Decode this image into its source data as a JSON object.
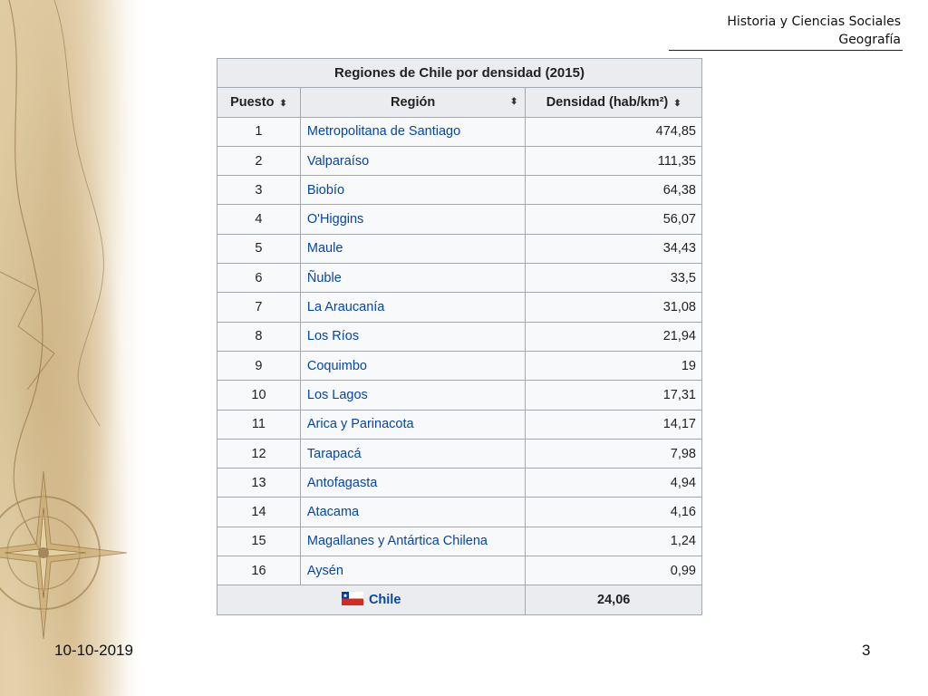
{
  "header": {
    "line1": "Historia y Ciencias Sociales",
    "line2": "Geografía"
  },
  "table": {
    "caption": "Regiones de Chile por densidad (2015)",
    "columns": [
      "Puesto",
      "Región",
      "Densidad (hab/km²)"
    ],
    "rows": [
      {
        "rank": "1",
        "region": "Metropolitana de Santiago",
        "density": "474,85"
      },
      {
        "rank": "2",
        "region": "Valparaíso",
        "density": "111,35"
      },
      {
        "rank": "3",
        "region": "Biobío",
        "density": "64,38"
      },
      {
        "rank": "4",
        "region": "O'Higgins",
        "density": "56,07"
      },
      {
        "rank": "5",
        "region": "Maule",
        "density": "34,43"
      },
      {
        "rank": "6",
        "region": "Ñuble",
        "density": "33,5"
      },
      {
        "rank": "7",
        "region": "La Araucanía",
        "density": "31,08"
      },
      {
        "rank": "8",
        "region": "Los Ríos",
        "density": "21,94"
      },
      {
        "rank": "9",
        "region": "Coquimbo",
        "density": "19"
      },
      {
        "rank": "10",
        "region": "Los Lagos",
        "density": "17,31"
      },
      {
        "rank": "11",
        "region": "Arica y Parinacota",
        "density": "14,17"
      },
      {
        "rank": "12",
        "region": "Tarapacá",
        "density": "7,98"
      },
      {
        "rank": "13",
        "region": "Antofagasta",
        "density": "4,94"
      },
      {
        "rank": "14",
        "region": "Atacama",
        "density": "4,16"
      },
      {
        "rank": "15",
        "region": "Magallanes y Antártica Chilena",
        "density": "1,24"
      },
      {
        "rank": "16",
        "region": "Aysén",
        "density": "0,99"
      }
    ],
    "total": {
      "label": "Chile",
      "density": "24,06"
    },
    "sort_glyph": "⬍"
  },
  "colors": {
    "link": "#0645ad",
    "header_bg": "#eaecf0",
    "cell_bg": "#f8f9fa",
    "border": "#a2a9b1"
  },
  "footer": {
    "date": "10-10-2019",
    "page": "3"
  }
}
